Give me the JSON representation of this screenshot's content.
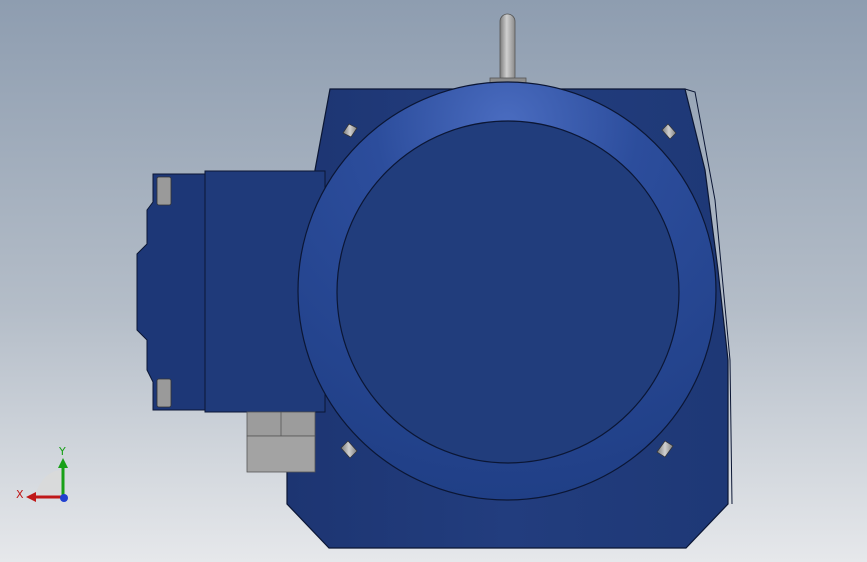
{
  "viewport": {
    "background_top": "#8e9db0",
    "background_bottom": "#e6e8eb"
  },
  "model": {
    "body_color": "#1f3a78",
    "body_edge": "#0a1530",
    "flange_color": "#2c4d9c",
    "face_color": "#213d7c",
    "metal_color": "#a8a8a8"
  },
  "triad": {
    "x_label": "X",
    "y_label": "Y",
    "x_color": "#c01818",
    "y_color": "#18a018",
    "z_color": "#2040d0"
  }
}
